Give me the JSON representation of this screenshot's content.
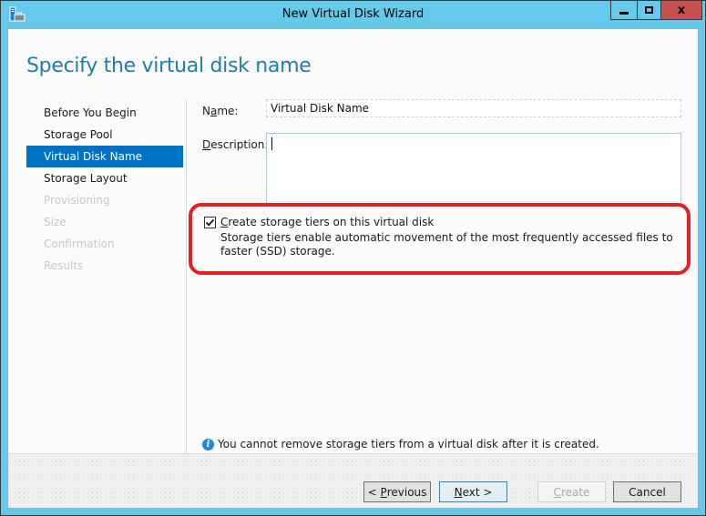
{
  "window": {
    "title": "New Virtual Disk Wizard",
    "close_glyph": "x"
  },
  "page": {
    "heading": "Specify the virtual disk name"
  },
  "nav": {
    "items": [
      {
        "label": "Before You Begin",
        "state": "normal"
      },
      {
        "label": "Storage Pool",
        "state": "normal"
      },
      {
        "label": "Virtual Disk Name",
        "state": "selected"
      },
      {
        "label": "Storage Layout",
        "state": "normal"
      },
      {
        "label": "Provisioning",
        "state": "disabled"
      },
      {
        "label": "Size",
        "state": "disabled"
      },
      {
        "label": "Confirmation",
        "state": "disabled"
      },
      {
        "label": "Results",
        "state": "disabled"
      }
    ]
  },
  "form": {
    "name_label_pre": "N",
    "name_label_access": "a",
    "name_label_post": "me:",
    "name_value": "Virtual Disk Name",
    "description_label_access": "D",
    "description_label_post": "escription:",
    "description_value": "",
    "tiers_checked": true,
    "tiers_label_access": "C",
    "tiers_label_post": "reate storage tiers on this virtual disk",
    "tiers_description": "Storage tiers enable automatic movement of the most frequently accessed files to faster (SSD) storage."
  },
  "info": {
    "icon": "info-icon",
    "text": "You cannot remove storage tiers from a virtual disk after it is created."
  },
  "buttons": {
    "previous_pre": "< ",
    "previous_access": "P",
    "previous_post": "revious",
    "next_access": "N",
    "next_post": "ext >",
    "create_access": "C",
    "create_post": "reate",
    "cancel": "Cancel"
  },
  "colors": {
    "accent": "#0072c6",
    "heading": "#1e7ea6",
    "frame": "#65c9e9",
    "close": "#c75050",
    "highlight": "#e41f25"
  }
}
